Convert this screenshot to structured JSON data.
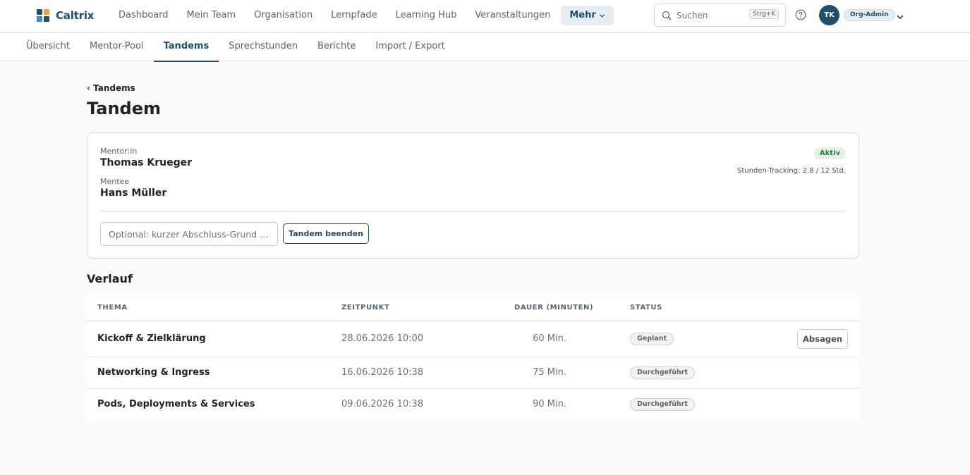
{
  "app": {
    "name": "Caltrix",
    "logo_colors": [
      "#1f4e6e",
      "#f0a23b",
      "#3a8fc4",
      "#1f4e6e"
    ]
  },
  "mainnav": {
    "items": [
      {
        "label": "Dashboard"
      },
      {
        "label": "Mein Team"
      },
      {
        "label": "Organisation"
      },
      {
        "label": "Lernpfade"
      },
      {
        "label": "Learning Hub"
      },
      {
        "label": "Veranstaltungen"
      }
    ],
    "more_label": "Mehr",
    "more_icon": "chevron-down-icon"
  },
  "search": {
    "placeholder": "Suchen",
    "shortcut": "Strg+K",
    "icon": "search-icon"
  },
  "user": {
    "initials": "TK",
    "role": "Org-Admin"
  },
  "subnav": {
    "tabs": [
      {
        "label": "Übersicht"
      },
      {
        "label": "Mentor-Pool"
      },
      {
        "label": "Tandems",
        "active": true
      },
      {
        "label": "Sprechstunden"
      },
      {
        "label": "Berichte"
      },
      {
        "label": "Import / Export"
      }
    ]
  },
  "page": {
    "back_label": "‹ Tandems",
    "title": "Tandem"
  },
  "tandem": {
    "mentor_label": "Mentor:in",
    "mentor_name": "Thomas Krueger",
    "mentee_label": "Mentee",
    "mentee_name": "Hans Müller",
    "status": "Aktiv",
    "tracking": "Stunden-Tracking: 2.8 / 12 Std.",
    "reason_placeholder": "Optional: kurzer Abschluss-Grund …",
    "end_label": "Tandem beenden"
  },
  "history": {
    "title": "Verlauf",
    "columns": [
      "THEMA",
      "ZEITPUNKT",
      "DAUER (MINUTEN)",
      "STATUS"
    ],
    "rows": [
      {
        "topic": "Kickoff & Zielklärung",
        "time": "28.06.2026 10:00",
        "duration": "60 Min.",
        "status": "Geplant",
        "action": "Absagen"
      },
      {
        "topic": "Networking & Ingress",
        "time": "16.06.2026 10:38",
        "duration": "75 Min.",
        "status": "Durchgeführt"
      },
      {
        "topic": "Pods, Deployments & Services",
        "time": "09.06.2026 10:38",
        "duration": "90 Min.",
        "status": "Durchgeführt"
      }
    ]
  }
}
